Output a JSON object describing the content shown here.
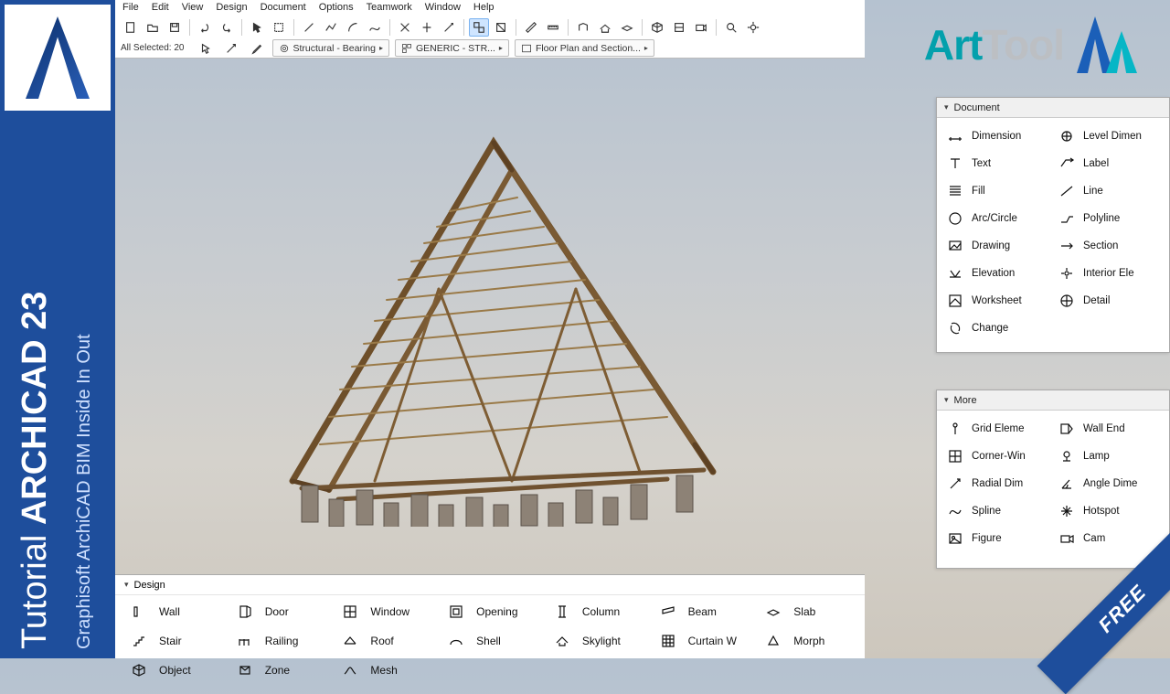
{
  "left_banner": {
    "line1_prefix": "Tutorial ",
    "line1_bold": "ARCHICAD 23",
    "line2": "Graphisoft ArchiCAD BIM Inside In Out"
  },
  "watermark": {
    "art": "Art",
    "tool": "Tool"
  },
  "menu": [
    "File",
    "Edit",
    "View",
    "Design",
    "Document",
    "Options",
    "Teamwork",
    "Window",
    "Help"
  ],
  "info": {
    "selection": "All Selected: 20",
    "layer": "Structural - Bearing",
    "material": "GENERIC - STR...",
    "viewset": "Floor Plan and Section..."
  },
  "palettes": {
    "document": {
      "title": "Document",
      "items": [
        {
          "name": "dimension",
          "label": "Dimension"
        },
        {
          "name": "level-dimension",
          "label": "Level Dimen"
        },
        {
          "name": "text",
          "label": "Text"
        },
        {
          "name": "label",
          "label": "Label"
        },
        {
          "name": "fill",
          "label": "Fill"
        },
        {
          "name": "line",
          "label": "Line"
        },
        {
          "name": "arc-circle",
          "label": "Arc/Circle"
        },
        {
          "name": "polyline",
          "label": "Polyline"
        },
        {
          "name": "drawing",
          "label": "Drawing"
        },
        {
          "name": "section",
          "label": "Section"
        },
        {
          "name": "elevation",
          "label": "Elevation"
        },
        {
          "name": "interior-elevation",
          "label": "Interior Ele"
        },
        {
          "name": "worksheet",
          "label": "Worksheet"
        },
        {
          "name": "detail",
          "label": "Detail"
        },
        {
          "name": "change",
          "label": "Change"
        }
      ]
    },
    "more": {
      "title": "More",
      "items": [
        {
          "name": "grid-element",
          "label": "Grid Eleme"
        },
        {
          "name": "wall-end",
          "label": "Wall End"
        },
        {
          "name": "corner-window",
          "label": "Corner-Win"
        },
        {
          "name": "lamp",
          "label": "Lamp"
        },
        {
          "name": "radial-dimension",
          "label": "Radial Dim"
        },
        {
          "name": "angle-dimension",
          "label": "Angle Dime"
        },
        {
          "name": "spline",
          "label": "Spline"
        },
        {
          "name": "hotspot",
          "label": "Hotspot"
        },
        {
          "name": "figure",
          "label": "Figure"
        },
        {
          "name": "camera",
          "label": "Cam"
        }
      ]
    }
  },
  "design": {
    "title": "Design",
    "items": [
      {
        "name": "wall",
        "label": "Wall"
      },
      {
        "name": "door",
        "label": "Door"
      },
      {
        "name": "window",
        "label": "Window"
      },
      {
        "name": "opening",
        "label": "Opening"
      },
      {
        "name": "column",
        "label": "Column"
      },
      {
        "name": "beam",
        "label": "Beam"
      },
      {
        "name": "slab",
        "label": "Slab"
      },
      {
        "name": "stair",
        "label": "Stair"
      },
      {
        "name": "railing",
        "label": "Railing"
      },
      {
        "name": "roof",
        "label": "Roof"
      },
      {
        "name": "shell",
        "label": "Shell"
      },
      {
        "name": "skylight",
        "label": "Skylight"
      },
      {
        "name": "curtain-wall",
        "label": "Curtain W"
      },
      {
        "name": "morph",
        "label": "Morph"
      },
      {
        "name": "object",
        "label": "Object"
      },
      {
        "name": "zone",
        "label": "Zone"
      },
      {
        "name": "mesh",
        "label": "Mesh"
      }
    ]
  },
  "ribbon": "FREE"
}
